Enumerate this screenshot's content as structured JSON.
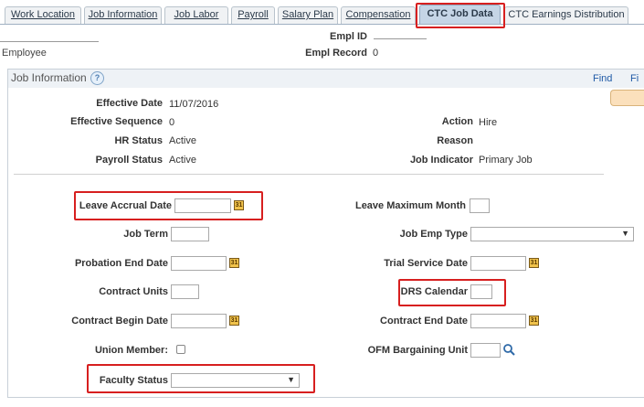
{
  "tabs": [
    {
      "label": "Work Location"
    },
    {
      "label": "Job Information"
    },
    {
      "label": "Job Labor"
    },
    {
      "label": "Payroll"
    },
    {
      "label": "Salary Plan"
    },
    {
      "label": "Compensation"
    },
    {
      "label": "CTC Job Data"
    },
    {
      "label": "CTC Earnings Distribution"
    }
  ],
  "header": {
    "employee_label": "Employee",
    "empl_id_label": "Empl ID",
    "empl_record_label": "Empl Record",
    "empl_record_value": "0"
  },
  "section": {
    "title": "Job Information",
    "help_glyph": "?",
    "find_label": "Find",
    "next_label": "Fi"
  },
  "info": {
    "effective_date_label": "Effective Date",
    "effective_date_value": "11/07/2016",
    "effective_sequence_label": "Effective Sequence",
    "effective_sequence_value": "0",
    "hr_status_label": "HR Status",
    "hr_status_value": "Active",
    "payroll_status_label": "Payroll Status",
    "payroll_status_value": "Active",
    "action_label": "Action",
    "action_value": "Hire",
    "reason_label": "Reason",
    "reason_value": "",
    "job_indicator_label": "Job Indicator",
    "job_indicator_value": "Primary Job"
  },
  "form": {
    "leave_accrual_date_label": "Leave Accrual Date",
    "leave_accrual_date_value": "",
    "leave_maximum_month_label": "Leave Maximum Month",
    "leave_maximum_month_value": "",
    "job_term_label": "Job Term",
    "job_term_value": "",
    "job_emp_type_label": "Job Emp Type",
    "job_emp_type_value": "",
    "probation_end_date_label": "Probation End Date",
    "probation_end_date_value": "",
    "trial_service_date_label": "Trial Service Date",
    "trial_service_date_value": "",
    "contract_units_label": "Contract Units",
    "contract_units_value": "",
    "drs_calendar_label": "DRS Calendar",
    "drs_calendar_value": "",
    "contract_begin_date_label": "Contract Begin Date",
    "contract_begin_date_value": "",
    "contract_end_date_label": "Contract End Date",
    "contract_end_date_value": "",
    "union_member_label": "Union Member:",
    "ofm_bargaining_unit_label": "OFM Bargaining Unit",
    "ofm_bargaining_unit_value": "",
    "faculty_status_label": "Faculty Status",
    "faculty_status_value": ""
  },
  "icons": {
    "calendar": "calendar-icon",
    "lookup": "magnifier-icon",
    "dropdown": "chevron-down-icon"
  },
  "colors": {
    "highlight": "#d71f1f",
    "active_tab": "#c5d5e6",
    "section_header": "#eef2f6",
    "link": "#1f5aa6"
  }
}
